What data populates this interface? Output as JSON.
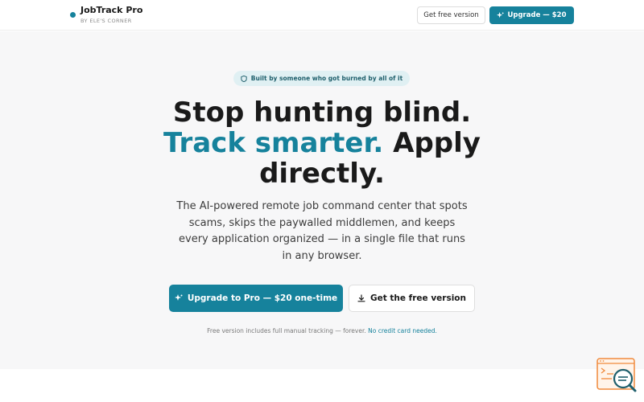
{
  "header": {
    "brand_name": "JobTrack Pro",
    "brand_sub": "BY ELE'S CORNER",
    "free_button": "Get free version",
    "upgrade_button": "Upgrade — $20"
  },
  "hero": {
    "pill_text": "Built by someone who got burned by all of it",
    "headline_line1": "Stop hunting blind.",
    "headline_accent": "Track smarter.",
    "headline_rest": "Apply",
    "headline_line3": "directly.",
    "subtitle": "The AI-powered remote job command center that spots scams, skips the paywalled middlemen, and keeps every application organized — in a single file that runs in any browser.",
    "upgrade_cta": "Upgrade to Pro — $20 one-time",
    "free_cta": "Get the free version",
    "footnote": "Free version includes full manual tracking — forever.",
    "footnote_link": "No credit card needed."
  },
  "colors": {
    "accent": "#16829c",
    "hero_bg": "#f7f7f8",
    "widget": "#f08a3c"
  },
  "icons": {
    "pill": "shield-icon",
    "upgrade": "sparkle-icon",
    "free": "download-icon",
    "widget": "search-help-icon"
  }
}
